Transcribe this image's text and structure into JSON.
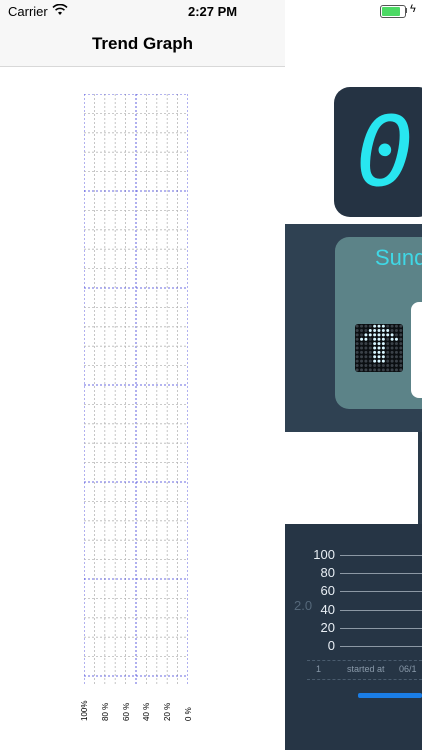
{
  "status": {
    "carrier": "Carrier",
    "time": "2:27 PM"
  },
  "nav": {
    "title": "Trend Graph"
  },
  "trend_graph": {
    "x_labels": [
      "100%",
      "80 %",
      "60 %",
      "40 %",
      "20 %",
      "0 %"
    ]
  },
  "right_panel": {
    "digital_display": "0",
    "card_title": "Sund",
    "arrow_icon": "up-arrow-icon",
    "y_axis_labels": [
      "100",
      "80",
      "60",
      "40",
      "20",
      "0"
    ],
    "ghost_value": "2.0",
    "row_index": "1",
    "row_label": "started at",
    "row_date": "06/1"
  },
  "colors": {
    "grid_major": "#3a3ad8",
    "grid_minor": "#b8b8b8",
    "panel_dark": "#263545",
    "digital_cyan": "#28e6f0",
    "progress_blue": "#1a7de6"
  }
}
